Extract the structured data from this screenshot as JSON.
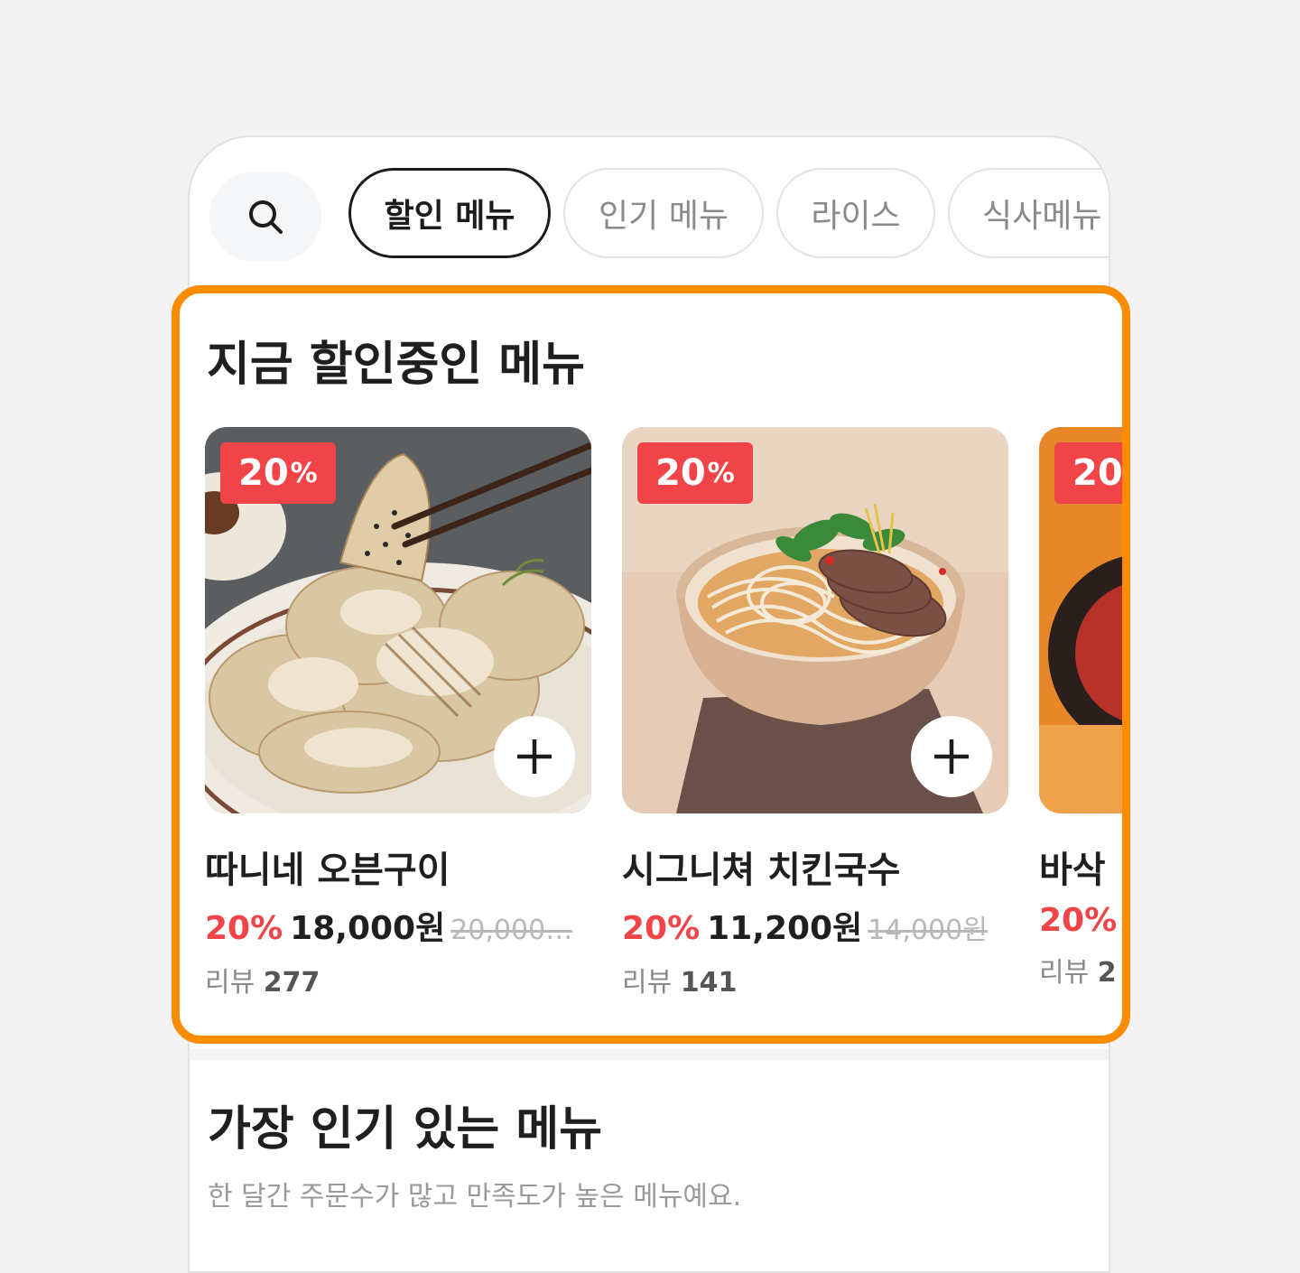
{
  "tabs": {
    "search_icon": "search-icon",
    "items": [
      "할인 메뉴",
      "인기 메뉴",
      "라이스",
      "식사메뉴"
    ],
    "active_index": 0
  },
  "discount_section": {
    "title": "지금 할인중인 메뉴",
    "cards": [
      {
        "badge_value": "20",
        "badge_unit": "%",
        "name": "따니네 오븐구이",
        "discount": "20%",
        "price": "18,000원",
        "original_price": "20,000…",
        "review_label": "리뷰",
        "review_count": "277"
      },
      {
        "badge_value": "20",
        "badge_unit": "%",
        "name": "시그니쳐 치킨국수",
        "discount": "20%",
        "price": "11,200원",
        "original_price": "14,000원",
        "review_label": "리뷰",
        "review_count": "141"
      },
      {
        "badge_value": "20",
        "badge_unit": "",
        "name": "바삭",
        "discount": "20%",
        "price": "",
        "original_price": "",
        "review_label": "리뷰",
        "review_count": "2"
      }
    ]
  },
  "popular_section": {
    "title": "가장 인기 있는 메뉴",
    "subtitle": "한 달간 주문수가 많고 만족도가 높은 메뉴예요."
  },
  "colors": {
    "accent_orange": "#fb8c00",
    "discount_red": "#f04448"
  }
}
